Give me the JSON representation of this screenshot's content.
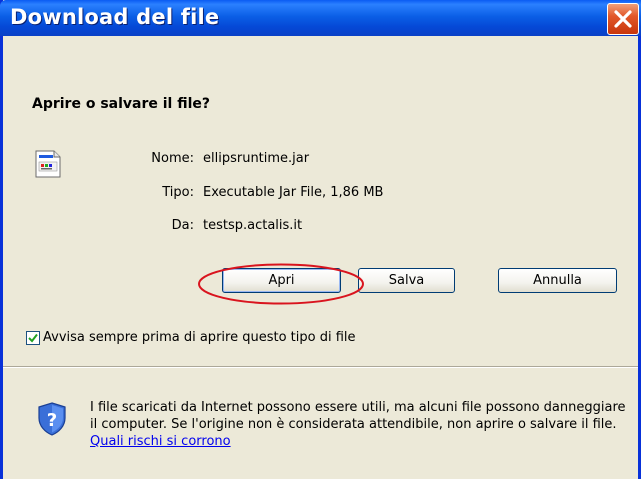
{
  "window": {
    "title": "Download del file"
  },
  "dialog": {
    "question": "Aprire o salvare il file?",
    "fields": [
      {
        "label": "Nome:",
        "value": "ellipsruntime.jar"
      },
      {
        "label": "Tipo:",
        "value": "Executable Jar File, 1,86 MB"
      },
      {
        "label": "Da:",
        "value": "testsp.actalis.it"
      }
    ],
    "buttons": {
      "open": "Apri",
      "save": "Salva",
      "cancel": "Annulla"
    },
    "checkbox": {
      "label": "Avvisa sempre prima di aprire questo tipo di file",
      "checked": true
    },
    "warning": {
      "text": "I file scaricati da Internet possono essere utili, ma alcuni file possono danneggiare il computer. Se l'origine non è considerata attendibile, non aprire o salvare il file.",
      "link": "Quali rischi si corrono"
    }
  },
  "colors": {
    "title_bar": "#0548d6",
    "highlight_ellipse": "#d9141e",
    "dialog_bg": "#ece9d8",
    "link": "#0000ee"
  }
}
